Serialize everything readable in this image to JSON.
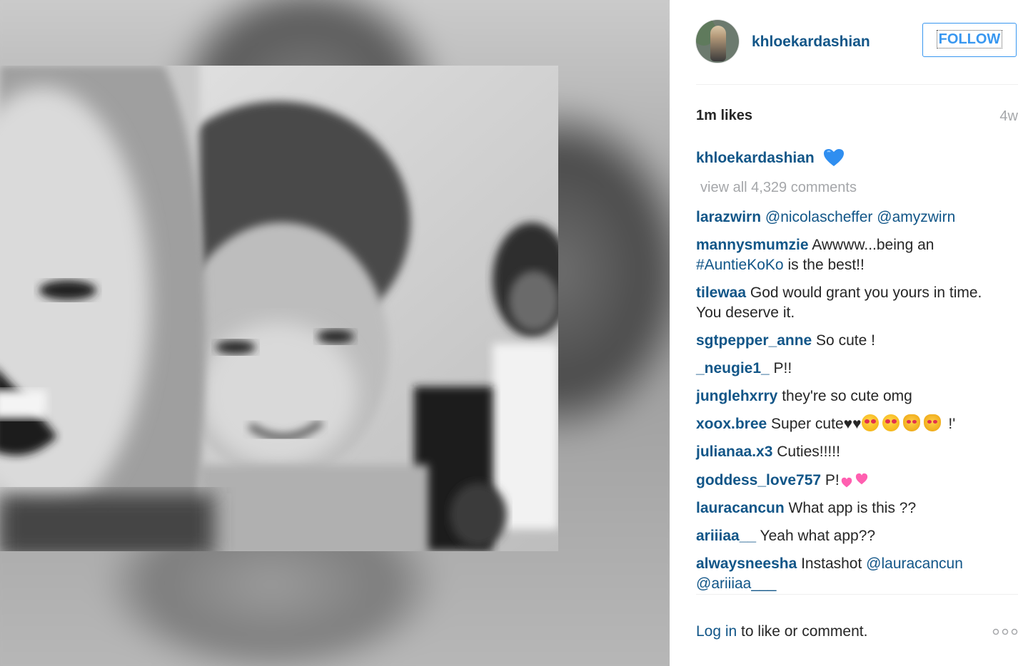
{
  "post": {
    "username": "khloekardashian",
    "follow_label": "FOLLOW",
    "likes": "1m likes",
    "time_ago": "4w",
    "caption": {
      "username": "khloekardashian",
      "emoji": "blue-heart"
    },
    "view_all_comments": "view all 4,329 comments"
  },
  "comments": [
    {
      "username": "larazwirn",
      "segments": [
        {
          "t": " "
        },
        {
          "t": "@nicolascheffer",
          "m": 1
        },
        {
          "t": " "
        },
        {
          "t": "@amyzwirn",
          "m": 1
        }
      ]
    },
    {
      "username": "mannysmumzie",
      "segments": [
        {
          "t": " Awwww...being an "
        },
        {
          "t": "#AuntieKoKo",
          "m": 1
        },
        {
          "t": " is the best!!"
        }
      ]
    },
    {
      "username": "tilewaa",
      "segments": [
        {
          "t": " God would grant you yours in time. You deserve it."
        }
      ]
    },
    {
      "username": "sgtpepper_anne",
      "segments": [
        {
          "t": " So cute !"
        }
      ]
    },
    {
      "username": "_neugie1_",
      "segments": [
        {
          "t": " P!!"
        }
      ]
    },
    {
      "username": "junglehxrry",
      "segments": [
        {
          "t": " they're so cute omg"
        }
      ]
    },
    {
      "username": "xoox.bree",
      "segments": [
        {
          "t": " Super cute♥♥"
        }
      ],
      "emojis": [
        "heart-eyes-face",
        "heart-eyes-face",
        "heart-eyes-cat",
        "heart-eyes-cat"
      ],
      "after": " !'"
    },
    {
      "username": "julianaa.x3",
      "segments": [
        {
          "t": " Cuties!!!!!"
        }
      ]
    },
    {
      "username": "goddess_love757",
      "segments": [
        {
          "t": " P!"
        }
      ],
      "hearts": "two-pink-hearts"
    },
    {
      "username": "lauracancun",
      "segments": [
        {
          "t": " What app is this ??"
        }
      ]
    },
    {
      "username": "ariiiaa__",
      "segments": [
        {
          "t": " Yeah what app??"
        }
      ]
    },
    {
      "username": "alwaysneesha",
      "segments": [
        {
          "t": " Instashot "
        },
        {
          "t": "@lauracancun",
          "m": 1
        },
        {
          "t": " "
        },
        {
          "t": "@ariiiaa___",
          "m": 1
        }
      ]
    }
  ],
  "footer": {
    "login_link": "Log in",
    "login_rest": " to like or comment.",
    "more_icon": "more-options-icon"
  },
  "colors": {
    "username": "#125688",
    "follow": "#3897f0",
    "muted": "#a5a7aa",
    "text": "#262626"
  }
}
